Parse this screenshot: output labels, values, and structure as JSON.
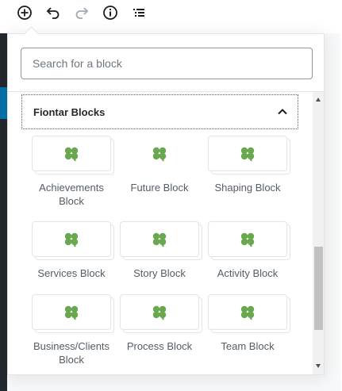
{
  "toolbar": {
    "buttons": [
      {
        "name": "add-block-icon",
        "label": "Add block"
      },
      {
        "name": "undo-icon",
        "label": "Undo"
      },
      {
        "name": "redo-icon",
        "label": "Redo"
      },
      {
        "name": "info-icon",
        "label": "Content structure"
      },
      {
        "name": "outline-icon",
        "label": "Block navigation"
      }
    ]
  },
  "inserter": {
    "search_placeholder": "Search for a block",
    "panel": {
      "title": "Fiontar Blocks",
      "expanded": true,
      "blocks": [
        {
          "label": "Achievements Block",
          "icon": "clover-icon"
        },
        {
          "label": "Future Block",
          "icon": "clover-icon"
        },
        {
          "label": "Shaping Block",
          "icon": "clover-icon"
        },
        {
          "label": "Services Block",
          "icon": "clover-icon"
        },
        {
          "label": "Story Block",
          "icon": "clover-icon"
        },
        {
          "label": "Activity Block",
          "icon": "clover-icon"
        },
        {
          "label": "Business/Clients Block",
          "icon": "clover-icon"
        },
        {
          "label": "Process Block",
          "icon": "clover-icon"
        },
        {
          "label": "Team Block",
          "icon": "clover-icon"
        }
      ]
    }
  },
  "colors": {
    "clover": "#6aa84f",
    "admin_sidebar": "#23282d",
    "admin_accent": "#0073aa"
  }
}
